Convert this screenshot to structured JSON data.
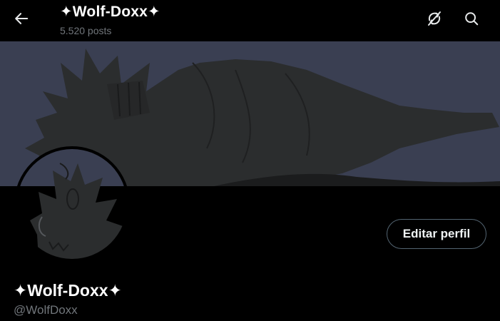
{
  "header": {
    "title": "✦Wolf-Doxx✦",
    "post_count": "5.520 posts"
  },
  "profile": {
    "display_name": "✦Wolf-Doxx✦",
    "handle": "@WolfDoxx",
    "edit_button_label": "Editar perfil"
  },
  "icons": {
    "back": "arrow-left-icon",
    "refresh": "refresh-off-icon",
    "search": "search-icon"
  },
  "colors": {
    "background": "#000000",
    "banner_bg": "#3a3f52",
    "secondary_text": "#71767b",
    "button_border": "#536471"
  }
}
